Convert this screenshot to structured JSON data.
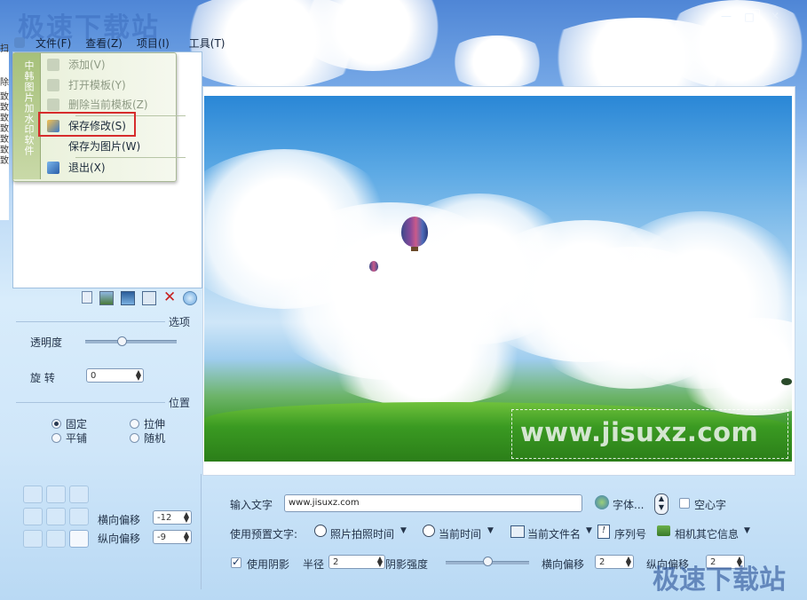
{
  "window": {
    "watermark_top": "极速下载站",
    "watermark_bottom": "极速下载站",
    "controls": {
      "minimize": "—",
      "maximize": "□",
      "close": "✕"
    }
  },
  "menu": {
    "file": "文件(F)",
    "view": "查看(Z)",
    "project": "项目(I)",
    "tools": "工具(T)"
  },
  "dropdown": {
    "sidebar_text": "中韩图片加水印软件",
    "items": [
      {
        "label": "添加(V)",
        "enabled": false,
        "icon": "add-icon"
      },
      {
        "label": "打开模板(Y)",
        "enabled": false,
        "icon": "open-template-icon"
      },
      {
        "label": "删除当前模板(Z)",
        "enabled": false,
        "icon": "delete-template-icon"
      },
      {
        "label": "保存修改(S)",
        "enabled": true,
        "icon": "save-icon",
        "highlighted": true
      },
      {
        "label": "保存为图片(W)",
        "enabled": true,
        "icon": "none"
      },
      {
        "label": "退出(X)",
        "enabled": true,
        "icon": "exit-icon"
      }
    ]
  },
  "left_strip": [
    "扫",
    "除",
    "致",
    "致",
    "致",
    "致",
    "致",
    "致",
    "致"
  ],
  "toolbar_icons": [
    "new-doc-icon",
    "image-icon",
    "picture-icon",
    "monitor-icon",
    "delete-x-icon",
    "globe-icon"
  ],
  "options": {
    "section_title": "选项",
    "opacity_label": "透明度",
    "opacity_value": 0.45,
    "rotate_label": "旋    转",
    "rotate_value": "0"
  },
  "position": {
    "section_title": "位置",
    "radios": [
      {
        "label": "固定",
        "checked": true
      },
      {
        "label": "拉伸",
        "checked": false
      },
      {
        "label": "平铺",
        "checked": false
      },
      {
        "label": "随机",
        "checked": false
      }
    ],
    "h_offset_label": "横向偏移",
    "h_offset_value": "-12",
    "v_offset_label": "纵向偏移",
    "v_offset_value": "-9"
  },
  "preview": {
    "watermark_text": "www.jisuxz.com"
  },
  "text_panel": {
    "input_label": "输入文字",
    "input_value": "www.jisuxz.com",
    "font_button": "字体...",
    "hollow_label": "空心字",
    "preset_label": "使用预置文字:",
    "presets": [
      {
        "label": "照片拍照时间",
        "icon": "clock-icon"
      },
      {
        "label": "当前时间",
        "icon": "clock-icon"
      },
      {
        "label": "当前文件名",
        "icon": "file-edit-icon"
      },
      {
        "label": "序列号",
        "icon": "serial-icon"
      },
      {
        "label": "相机其它信息",
        "icon": "camera-info-icon"
      }
    ],
    "shadow_label": "使用阴影",
    "shadow_checked": true,
    "radius_label": "半径",
    "radius_value": "2",
    "shadow_strength_label": "阴影强度",
    "shadow_strength_value": 0.45,
    "h_offset_label": "横向偏移",
    "h_offset_value": "2",
    "v_offset_label": "纵向偏移",
    "v_offset_value": "2"
  }
}
